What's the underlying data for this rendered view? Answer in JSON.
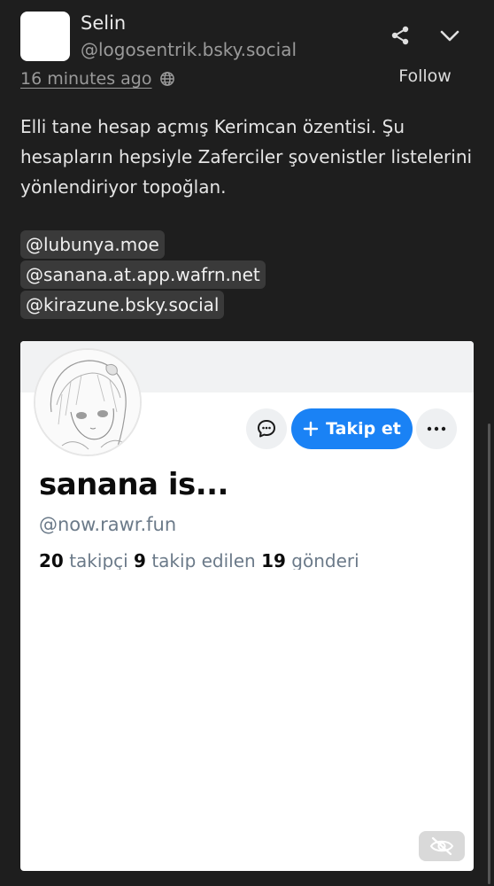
{
  "author": {
    "display_name": "Selin",
    "handle": "@logosentrik.bsky.social",
    "timestamp": "16 minutes ago",
    "follow_label": "Follow"
  },
  "post": {
    "paragraph": "Elli tane hesap açmış Kerimcan özentisi. Şu hesapların hepsiyle Zaferciler şovenistler listelerini yönlendiriyor topoğlan.",
    "mentions": [
      "@lubunya.moe",
      "@sanana.at.app.wafrn.net",
      "@kirazune.bsky.social"
    ]
  },
  "embed": {
    "follow_label": "Takip et",
    "profile_name": "sanana is...",
    "profile_handle": "@now.rawr.fun",
    "stats": {
      "followers_count": "20",
      "followers_label": "takipçi",
      "following_count": "9",
      "following_label": "takip edilen",
      "posts_count": "19",
      "posts_label": "gönderi"
    }
  },
  "icons": {
    "share": "share-icon",
    "chevron": "chevron-down-icon",
    "globe": "globe-icon",
    "message": "message-bubble-icon",
    "plus": "plus-icon",
    "more": "ellipsis-icon",
    "hide": "eye-slash-icon"
  },
  "colors": {
    "background": "#1e1e1e",
    "accent": "#1a82f5",
    "mention_bg": "#3a3a3a"
  }
}
